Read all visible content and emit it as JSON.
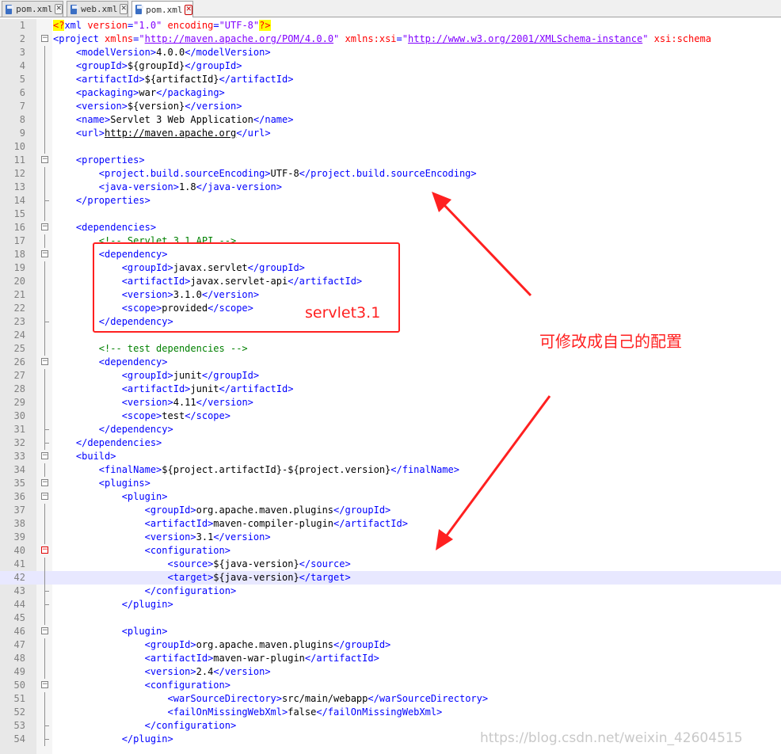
{
  "tabs": [
    {
      "label": "pom.xml"
    },
    {
      "label": "web.xml"
    },
    {
      "label": "pom.xml"
    }
  ],
  "annotations": {
    "box_label": "servlet3.1",
    "arrow_note": "可修改成自己的配置",
    "watermark": "https://blog.csdn.net/weixin_42604515",
    "accent_color": "#ff2020"
  },
  "lines": [
    {
      "n": "1",
      "fold": "",
      "current": false,
      "tokens": [
        [
          "p",
          "<?"
        ],
        [
          "t",
          "xml"
        ],
        [
          "a",
          " version"
        ],
        [
          "t",
          "="
        ],
        [
          "v",
          "\"1.0\""
        ],
        [
          "a",
          " encoding"
        ],
        [
          "t",
          "="
        ],
        [
          "v",
          "\"UTF-8\""
        ],
        [
          "p",
          "?>"
        ]
      ]
    },
    {
      "n": "2",
      "fold": "open",
      "current": false,
      "tokens": [
        [
          "t",
          "<project"
        ],
        [
          "a",
          " xmlns"
        ],
        [
          "t",
          "="
        ],
        [
          "v",
          "\""
        ],
        [
          "vu",
          "http://maven.apache.org/POM/4.0.0"
        ],
        [
          "v",
          "\""
        ],
        [
          "a",
          " xmlns:xsi"
        ],
        [
          "t",
          "="
        ],
        [
          "v",
          "\""
        ],
        [
          "vu",
          "http://www.w3.org/2001/XMLSchema-instance"
        ],
        [
          "v",
          "\""
        ],
        [
          "a",
          " xsi:schema"
        ]
      ]
    },
    {
      "n": "3",
      "fold": "line",
      "current": false,
      "tokens": [
        [
          "x",
          "    "
        ],
        [
          "t",
          "<modelVersion>"
        ],
        [
          "x",
          "4.0.0"
        ],
        [
          "t",
          "</modelVersion>"
        ]
      ]
    },
    {
      "n": "4",
      "fold": "line",
      "current": false,
      "tokens": [
        [
          "x",
          "    "
        ],
        [
          "t",
          "<groupId>"
        ],
        [
          "x",
          "${groupId}"
        ],
        [
          "t",
          "</groupId>"
        ]
      ]
    },
    {
      "n": "5",
      "fold": "line",
      "current": false,
      "tokens": [
        [
          "x",
          "    "
        ],
        [
          "t",
          "<artifactId>"
        ],
        [
          "x",
          "${artifactId}"
        ],
        [
          "t",
          "</artifactId>"
        ]
      ]
    },
    {
      "n": "6",
      "fold": "line",
      "current": false,
      "tokens": [
        [
          "x",
          "    "
        ],
        [
          "t",
          "<packaging>"
        ],
        [
          "x",
          "war"
        ],
        [
          "t",
          "</packaging>"
        ]
      ]
    },
    {
      "n": "7",
      "fold": "line",
      "current": false,
      "tokens": [
        [
          "x",
          "    "
        ],
        [
          "t",
          "<version>"
        ],
        [
          "x",
          "${version}"
        ],
        [
          "t",
          "</version>"
        ]
      ]
    },
    {
      "n": "8",
      "fold": "line",
      "current": false,
      "tokens": [
        [
          "x",
          "    "
        ],
        [
          "t",
          "<name>"
        ],
        [
          "x",
          "Servlet 3 Web Application"
        ],
        [
          "t",
          "</name>"
        ]
      ]
    },
    {
      "n": "9",
      "fold": "line",
      "current": false,
      "tokens": [
        [
          "x",
          "    "
        ],
        [
          "t",
          "<url>"
        ],
        [
          "xu",
          "http://maven.apache.org"
        ],
        [
          "t",
          "</url>"
        ]
      ]
    },
    {
      "n": "10",
      "fold": "line",
      "current": false,
      "tokens": []
    },
    {
      "n": "11",
      "fold": "open",
      "current": false,
      "tokens": [
        [
          "x",
          "    "
        ],
        [
          "t",
          "<properties>"
        ]
      ]
    },
    {
      "n": "12",
      "fold": "line",
      "current": false,
      "tokens": [
        [
          "x",
          "        "
        ],
        [
          "t",
          "<project.build.sourceEncoding>"
        ],
        [
          "x",
          "UTF-8"
        ],
        [
          "t",
          "</project.build.sourceEncoding>"
        ]
      ]
    },
    {
      "n": "13",
      "fold": "line",
      "current": false,
      "tokens": [
        [
          "x",
          "        "
        ],
        [
          "t",
          "<java-version>"
        ],
        [
          "x",
          "1.8"
        ],
        [
          "t",
          "</java-version>"
        ]
      ]
    },
    {
      "n": "14",
      "fold": "end",
      "current": false,
      "tokens": [
        [
          "x",
          "    "
        ],
        [
          "t",
          "</properties>"
        ]
      ]
    },
    {
      "n": "15",
      "fold": "line",
      "current": false,
      "tokens": []
    },
    {
      "n": "16",
      "fold": "open",
      "current": false,
      "tokens": [
        [
          "x",
          "    "
        ],
        [
          "t",
          "<dependencies>"
        ]
      ]
    },
    {
      "n": "17",
      "fold": "line",
      "current": false,
      "tokens": [
        [
          "x",
          "        "
        ],
        [
          "c",
          "<!-- Servlet 3.1 API -->"
        ]
      ]
    },
    {
      "n": "18",
      "fold": "open",
      "current": false,
      "tokens": [
        [
          "x",
          "        "
        ],
        [
          "t",
          "<dependency>"
        ]
      ]
    },
    {
      "n": "19",
      "fold": "line",
      "current": false,
      "tokens": [
        [
          "x",
          "            "
        ],
        [
          "t",
          "<groupId>"
        ],
        [
          "x",
          "javax.servlet"
        ],
        [
          "t",
          "</groupId>"
        ]
      ]
    },
    {
      "n": "20",
      "fold": "line",
      "current": false,
      "tokens": [
        [
          "x",
          "            "
        ],
        [
          "t",
          "<artifactId>"
        ],
        [
          "x",
          "javax.servlet-api"
        ],
        [
          "t",
          "</artifactId>"
        ]
      ]
    },
    {
      "n": "21",
      "fold": "line",
      "current": false,
      "tokens": [
        [
          "x",
          "            "
        ],
        [
          "t",
          "<version>"
        ],
        [
          "x",
          "3.1.0"
        ],
        [
          "t",
          "</version>"
        ]
      ]
    },
    {
      "n": "22",
      "fold": "line",
      "current": false,
      "tokens": [
        [
          "x",
          "            "
        ],
        [
          "t",
          "<scope>"
        ],
        [
          "x",
          "provided"
        ],
        [
          "t",
          "</scope>"
        ]
      ]
    },
    {
      "n": "23",
      "fold": "end",
      "current": false,
      "tokens": [
        [
          "x",
          "        "
        ],
        [
          "t",
          "</dependency>"
        ]
      ]
    },
    {
      "n": "24",
      "fold": "line",
      "current": false,
      "tokens": []
    },
    {
      "n": "25",
      "fold": "line",
      "current": false,
      "tokens": [
        [
          "x",
          "        "
        ],
        [
          "c",
          "<!-- test dependencies -->"
        ]
      ]
    },
    {
      "n": "26",
      "fold": "open",
      "current": false,
      "tokens": [
        [
          "x",
          "        "
        ],
        [
          "t",
          "<dependency>"
        ]
      ]
    },
    {
      "n": "27",
      "fold": "line",
      "current": false,
      "tokens": [
        [
          "x",
          "            "
        ],
        [
          "t",
          "<groupId>"
        ],
        [
          "x",
          "junit"
        ],
        [
          "t",
          "</groupId>"
        ]
      ]
    },
    {
      "n": "28",
      "fold": "line",
      "current": false,
      "tokens": [
        [
          "x",
          "            "
        ],
        [
          "t",
          "<artifactId>"
        ],
        [
          "x",
          "junit"
        ],
        [
          "t",
          "</artifactId>"
        ]
      ]
    },
    {
      "n": "29",
      "fold": "line",
      "current": false,
      "tokens": [
        [
          "x",
          "            "
        ],
        [
          "t",
          "<version>"
        ],
        [
          "x",
          "4.11"
        ],
        [
          "t",
          "</version>"
        ]
      ]
    },
    {
      "n": "30",
      "fold": "line",
      "current": false,
      "tokens": [
        [
          "x",
          "            "
        ],
        [
          "t",
          "<scope>"
        ],
        [
          "x",
          "test"
        ],
        [
          "t",
          "</scope>"
        ]
      ]
    },
    {
      "n": "31",
      "fold": "end",
      "current": false,
      "tokens": [
        [
          "x",
          "        "
        ],
        [
          "t",
          "</dependency>"
        ]
      ]
    },
    {
      "n": "32",
      "fold": "end",
      "current": false,
      "tokens": [
        [
          "x",
          "    "
        ],
        [
          "t",
          "</dependencies>"
        ]
      ]
    },
    {
      "n": "33",
      "fold": "open",
      "current": false,
      "tokens": [
        [
          "x",
          "    "
        ],
        [
          "t",
          "<build>"
        ]
      ]
    },
    {
      "n": "34",
      "fold": "line",
      "current": false,
      "tokens": [
        [
          "x",
          "        "
        ],
        [
          "t",
          "<finalName>"
        ],
        [
          "x",
          "${project.artifactId}-${project.version}"
        ],
        [
          "t",
          "</finalName>"
        ]
      ]
    },
    {
      "n": "35",
      "fold": "open",
      "current": false,
      "tokens": [
        [
          "x",
          "        "
        ],
        [
          "t",
          "<plugins>"
        ]
      ]
    },
    {
      "n": "36",
      "fold": "open",
      "current": false,
      "tokens": [
        [
          "x",
          "            "
        ],
        [
          "t",
          "<plugin>"
        ]
      ]
    },
    {
      "n": "37",
      "fold": "line",
      "current": false,
      "tokens": [
        [
          "x",
          "                "
        ],
        [
          "t",
          "<groupId>"
        ],
        [
          "x",
          "org.apache.maven.plugins"
        ],
        [
          "t",
          "</groupId>"
        ]
      ]
    },
    {
      "n": "38",
      "fold": "line",
      "current": false,
      "tokens": [
        [
          "x",
          "                "
        ],
        [
          "t",
          "<artifactId>"
        ],
        [
          "x",
          "maven-compiler-plugin"
        ],
        [
          "t",
          "</artifactId>"
        ]
      ]
    },
    {
      "n": "39",
      "fold": "line",
      "current": false,
      "tokens": [
        [
          "x",
          "                "
        ],
        [
          "t",
          "<version>"
        ],
        [
          "x",
          "3.1"
        ],
        [
          "t",
          "</version>"
        ]
      ]
    },
    {
      "n": "40",
      "fold": "openred",
      "current": false,
      "tokens": [
        [
          "x",
          "                "
        ],
        [
          "t",
          "<configuration>"
        ]
      ]
    },
    {
      "n": "41",
      "fold": "line",
      "current": false,
      "tokens": [
        [
          "x",
          "                    "
        ],
        [
          "t",
          "<source>"
        ],
        [
          "x",
          "${java-version}"
        ],
        [
          "t",
          "</source>"
        ]
      ]
    },
    {
      "n": "42",
      "fold": "line",
      "current": true,
      "tokens": [
        [
          "x",
          "                    "
        ],
        [
          "t",
          "<target>"
        ],
        [
          "x",
          "${java-version}"
        ],
        [
          "t",
          "</target>"
        ]
      ]
    },
    {
      "n": "43",
      "fold": "end",
      "current": false,
      "tokens": [
        [
          "x",
          "                "
        ],
        [
          "t",
          "</configuration>"
        ]
      ]
    },
    {
      "n": "44",
      "fold": "end",
      "current": false,
      "tokens": [
        [
          "x",
          "            "
        ],
        [
          "t",
          "</plugin>"
        ]
      ]
    },
    {
      "n": "45",
      "fold": "line",
      "current": false,
      "tokens": []
    },
    {
      "n": "46",
      "fold": "open",
      "current": false,
      "tokens": [
        [
          "x",
          "            "
        ],
        [
          "t",
          "<plugin>"
        ]
      ]
    },
    {
      "n": "47",
      "fold": "line",
      "current": false,
      "tokens": [
        [
          "x",
          "                "
        ],
        [
          "t",
          "<groupId>"
        ],
        [
          "x",
          "org.apache.maven.plugins"
        ],
        [
          "t",
          "</groupId>"
        ]
      ]
    },
    {
      "n": "48",
      "fold": "line",
      "current": false,
      "tokens": [
        [
          "x",
          "                "
        ],
        [
          "t",
          "<artifactId>"
        ],
        [
          "x",
          "maven-war-plugin"
        ],
        [
          "t",
          "</artifactId>"
        ]
      ]
    },
    {
      "n": "49",
      "fold": "line",
      "current": false,
      "tokens": [
        [
          "x",
          "                "
        ],
        [
          "t",
          "<version>"
        ],
        [
          "x",
          "2.4"
        ],
        [
          "t",
          "</version>"
        ]
      ]
    },
    {
      "n": "50",
      "fold": "open",
      "current": false,
      "tokens": [
        [
          "x",
          "                "
        ],
        [
          "t",
          "<configuration>"
        ]
      ]
    },
    {
      "n": "51",
      "fold": "line",
      "current": false,
      "tokens": [
        [
          "x",
          "                    "
        ],
        [
          "t",
          "<warSourceDirectory>"
        ],
        [
          "x",
          "src/main/webapp"
        ],
        [
          "t",
          "</warSourceDirectory>"
        ]
      ]
    },
    {
      "n": "52",
      "fold": "line",
      "current": false,
      "tokens": [
        [
          "x",
          "                    "
        ],
        [
          "t",
          "<failOnMissingWebXml>"
        ],
        [
          "x",
          "false"
        ],
        [
          "t",
          "</failOnMissingWebXml>"
        ]
      ]
    },
    {
      "n": "53",
      "fold": "end",
      "current": false,
      "tokens": [
        [
          "x",
          "                "
        ],
        [
          "t",
          "</configuration>"
        ]
      ]
    },
    {
      "n": "54",
      "fold": "end",
      "current": false,
      "tokens": [
        [
          "x",
          "            "
        ],
        [
          "t",
          "</plugin>"
        ]
      ]
    }
  ]
}
